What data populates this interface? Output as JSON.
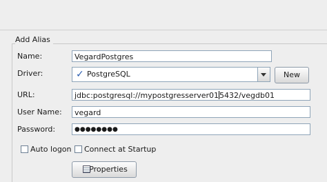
{
  "dialog": {
    "group_title": "Add Alias"
  },
  "form": {
    "name_label": "Name:",
    "name_value": "VegardPostgres",
    "driver_label": "Driver:",
    "driver_value": "PostgreSQL",
    "driver_icon": "check-icon",
    "new_button_label": "New",
    "url_label": "URL:",
    "url_value_before_caret": "jdbc:postgresql://mypostgresserver01",
    "url_value_after_caret": "5432/vegdb01",
    "username_label": "User Name:",
    "username_value": "vegard",
    "password_label": "Password:",
    "password_value": "●●●●●●●●",
    "auto_logon_label": "Auto logon",
    "auto_logon_checked": false,
    "connect_startup_label": "Connect at Startup",
    "connect_startup_checked": false,
    "properties_button_label": "Properties",
    "properties_icon": "properties-icon"
  }
}
